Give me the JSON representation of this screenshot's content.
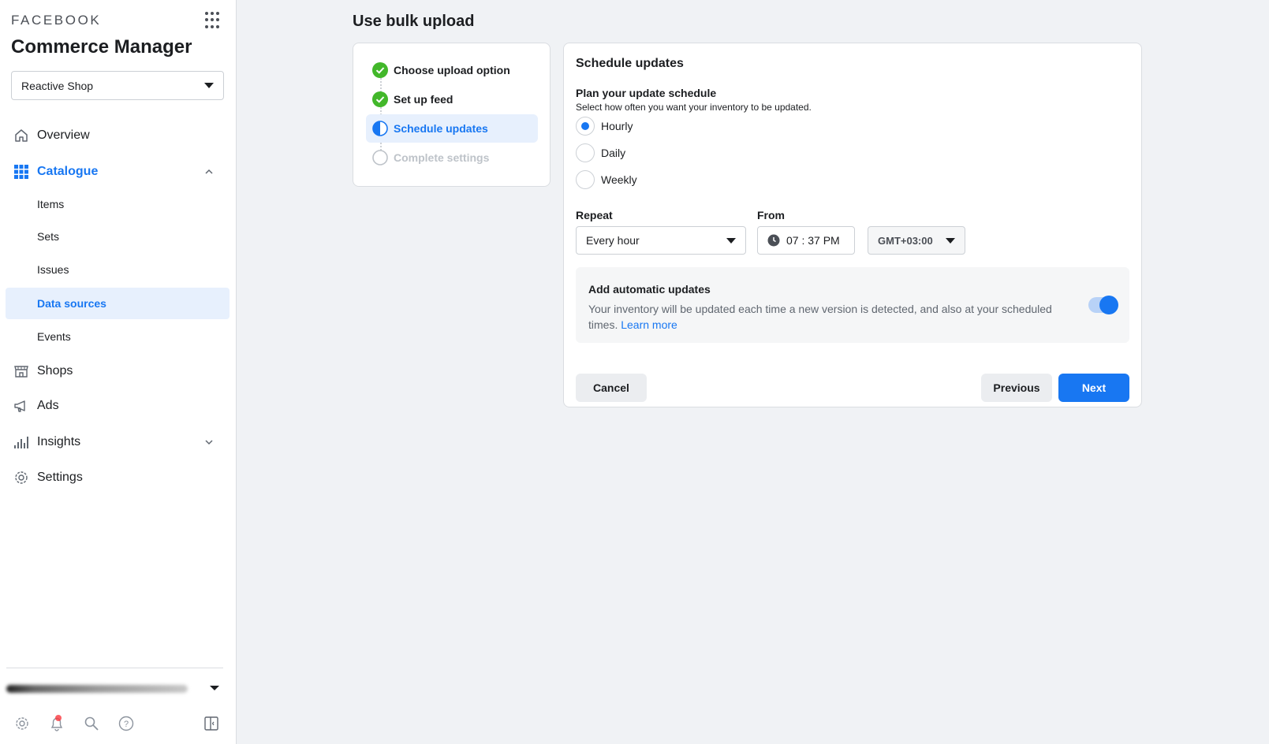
{
  "sidebar": {
    "brand": "FACEBOOK",
    "app_title": "Commerce Manager",
    "shop_selector": "Reactive Shop",
    "nav": {
      "overview": "Overview",
      "catalogue": "Catalogue",
      "catalogue_items": [
        "Items",
        "Sets",
        "Issues",
        "Data sources",
        "Events"
      ],
      "shops": "Shops",
      "ads": "Ads",
      "insights": "Insights",
      "settings": "Settings"
    }
  },
  "page": {
    "title": "Use bulk upload"
  },
  "steps": [
    {
      "label": "Choose upload option",
      "status": "done"
    },
    {
      "label": "Set up feed",
      "status": "done"
    },
    {
      "label": "Schedule updates",
      "status": "current"
    },
    {
      "label": "Complete settings",
      "status": "pending"
    }
  ],
  "form": {
    "title": "Schedule updates",
    "plan_title": "Plan your update schedule",
    "plan_desc": "Select how often you want your inventory to be updated.",
    "frequency_options": [
      "Hourly",
      "Daily",
      "Weekly"
    ],
    "frequency_selected": "Hourly",
    "repeat_label": "Repeat",
    "repeat_value": "Every hour",
    "from_label": "From",
    "from_time": "07 : 37 PM",
    "timezone": "GMT+03:00",
    "auto_updates_title": "Add automatic updates",
    "auto_updates_desc": "Your inventory will be updated each time a new version is detected, and also at your scheduled times.",
    "learn_more": "Learn more",
    "auto_updates_enabled": true,
    "cancel": "Cancel",
    "previous": "Previous",
    "next": "Next"
  },
  "colors": {
    "accent": "#1877f2",
    "success": "#42b72a",
    "background": "#f0f2f5"
  }
}
